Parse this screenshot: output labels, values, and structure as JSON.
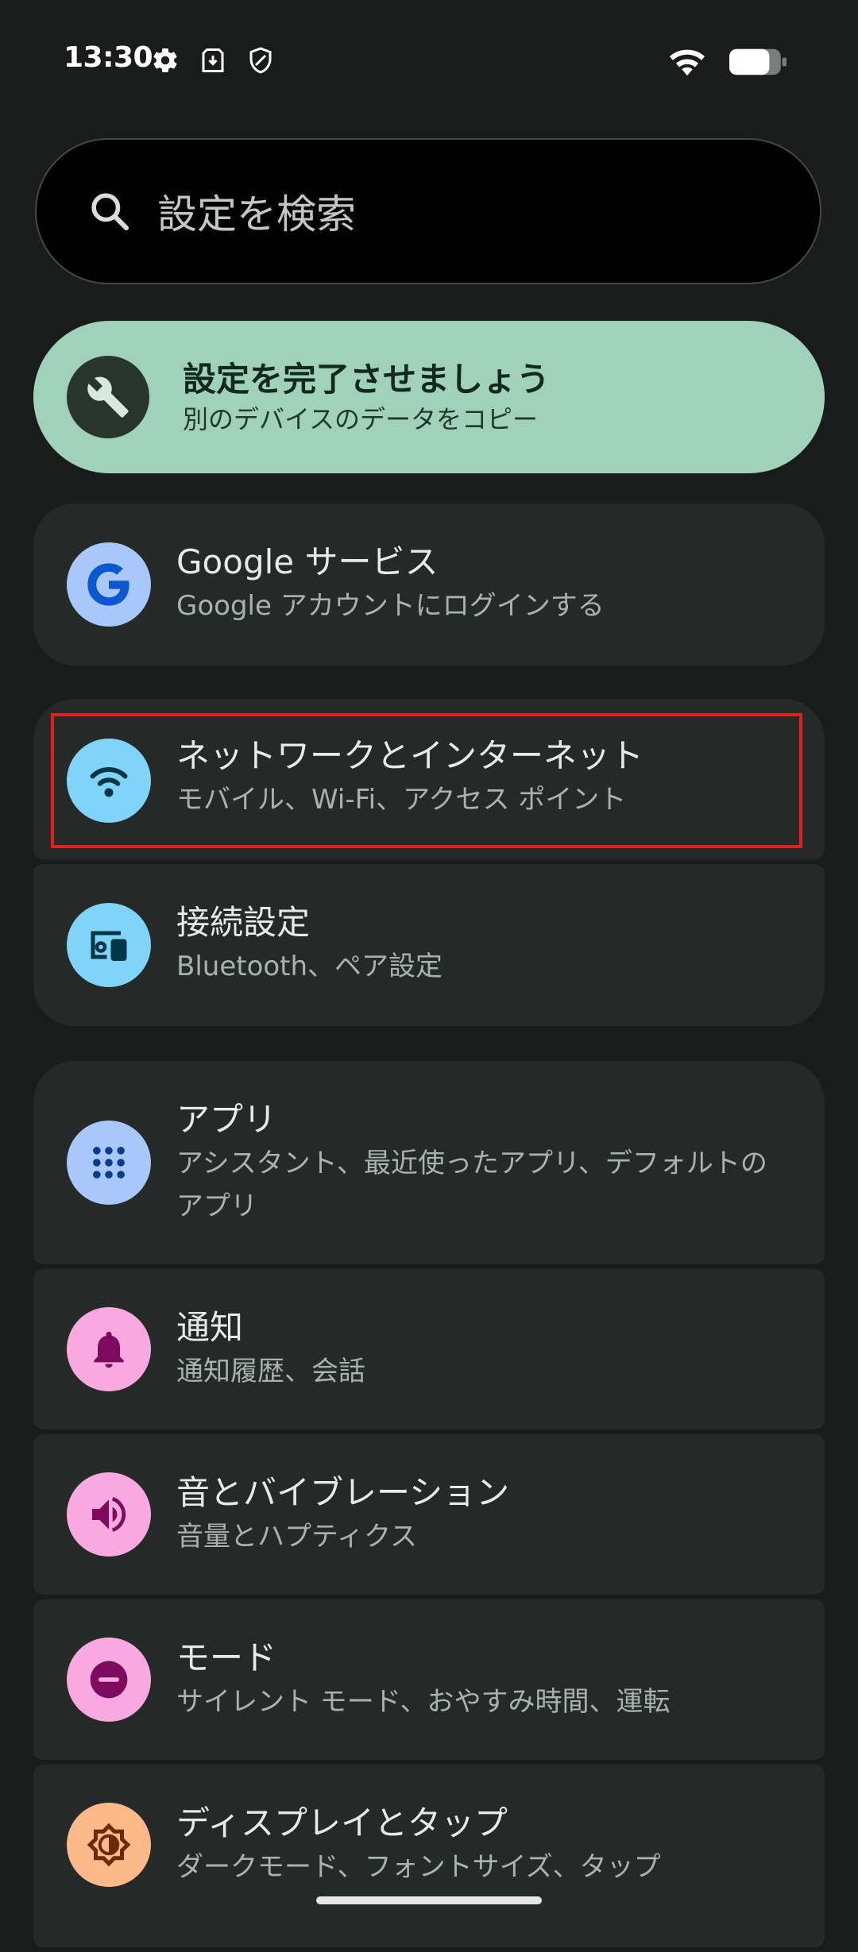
{
  "status_bar": {
    "time": "13:30",
    "left_icons": [
      "gear-icon",
      "download-icon",
      "shield-icon"
    ],
    "right_icons": [
      "wifi-icon",
      "battery-icon"
    ]
  },
  "search": {
    "placeholder": "設定を検索"
  },
  "setup_card": {
    "title": "設定を完了させましょう",
    "subtitle": "別のデバイスのデータをコピー",
    "icon": "wrench-icon",
    "color": "#a2d1bb"
  },
  "settings": [
    {
      "title": "Google サービス",
      "subtitle": "Google アカウントにログインする",
      "icon": "google-icon",
      "icon_bg": "#a8c7fa"
    },
    {
      "title": "ネットワークとインターネット",
      "subtitle": "モバイル、Wi-Fi、アクセス ポイント",
      "icon": "wifi-icon",
      "icon_bg": "#7fd4f7"
    },
    {
      "title": "接続設定",
      "subtitle": "Bluetooth、ペア設定",
      "icon": "devices-icon",
      "icon_bg": "#7fd4f7"
    },
    {
      "title": "アプリ",
      "subtitle": "アシスタント、最近使ったアプリ、デフォルトのアプリ",
      "icon": "apps-grid-icon",
      "icon_bg": "#a8c7fa"
    },
    {
      "title": "通知",
      "subtitle": "通知履歴、会話",
      "icon": "bell-icon",
      "icon_bg": "#f7a9e0"
    },
    {
      "title": "音とバイブレーション",
      "subtitle": "音量とハプティクス",
      "icon": "speaker-icon",
      "icon_bg": "#f7a9e0"
    },
    {
      "title": "モード",
      "subtitle": "サイレント モード、おやすみ時間、運転",
      "icon": "do-not-disturb-icon",
      "icon_bg": "#f7a9e0"
    },
    {
      "title": "ディスプレイとタップ",
      "subtitle": "ダークモード、フォントサイズ、タップ",
      "icon": "brightness-icon",
      "icon_bg": "#fdb98a"
    }
  ],
  "highlight_color": "#e0201f"
}
